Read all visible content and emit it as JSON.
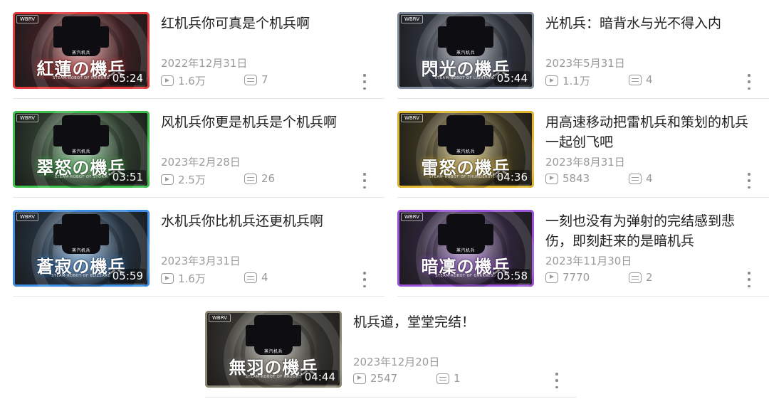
{
  "videos": [
    {
      "title": "红机兵你可真是个机兵啊",
      "date": "2022年12月31日",
      "views": "1.6万",
      "comments": "7",
      "duration": "05:24",
      "thumb": {
        "logo": "WBRV",
        "subtitle": "蒸汽机兵",
        "title": "紅蓮の機兵",
        "caption": "STEAM-ROBOT OF INFERNO",
        "bg": "#3a1f22",
        "accent": "#e23a3a"
      }
    },
    {
      "title": "光机兵：暗背水与光不得入内",
      "date": "2023年5月31日",
      "views": "1.1万",
      "comments": "4",
      "duration": "05:44",
      "thumb": {
        "logo": "WBRV",
        "subtitle": "蒸汽机兵",
        "title": "閃光の機兵",
        "caption": "STEAM-ROBOT OF LIGHTNING",
        "bg": "#2b2f38",
        "accent": "#7f8a9c"
      }
    },
    {
      "title": "风机兵你更是机兵是个机兵啊",
      "date": "2023年2月28日",
      "views": "2.5万",
      "comments": "26",
      "duration": "03:51",
      "thumb": {
        "logo": "WBRV",
        "subtitle": "蒸汽机兵",
        "title": "翠怒の機兵",
        "caption": "STEAM-ROBOT OF STORM",
        "bg": "#2d3b2d",
        "accent": "#3bbf4a"
      }
    },
    {
      "title": "用高速移动把雷机兵和策划的机兵一起创飞吧",
      "date": "2023年8月31日",
      "views": "5843",
      "comments": "4",
      "duration": "04:36",
      "thumb": {
        "logo": "WBRV",
        "subtitle": "蒸汽机兵",
        "title": "雷怒の機兵",
        "caption": "STEAM-ROBOT OF THUNDERSTORM",
        "bg": "#3a3420",
        "accent": "#e0b62c"
      }
    },
    {
      "title": "水机兵你比机兵还更机兵啊",
      "date": "2023年3月31日",
      "views": "1.6万",
      "comments": "4",
      "duration": "05:59",
      "thumb": {
        "logo": "WBRV",
        "subtitle": "蒸汽机兵",
        "title": "蒼寂の機兵",
        "caption": "STEAM-ROBOT OF BLIZZARD",
        "bg": "#23303d",
        "accent": "#3b8be0"
      }
    },
    {
      "title": "一刻也没有为弹射的完结感到悲伤，即刻赶来的是暗机兵",
      "date": "2023年11月30日",
      "views": "7770",
      "comments": "2",
      "duration": "05:58",
      "thumb": {
        "logo": "WBRV",
        "subtitle": "蒸汽机兵",
        "title": "暗凜の機兵",
        "caption": "STEAM-ROBOT OF DARKNESS",
        "bg": "#2d2438",
        "accent": "#9b52d8"
      }
    },
    {
      "title": "机兵道，堂堂完结！",
      "date": "2023年12月20日",
      "views": "2547",
      "comments": "1",
      "duration": "04:44",
      "thumb": {
        "logo": "WBRV",
        "subtitle": "蒸汽机兵",
        "title": "無羽の機兵",
        "caption": "STEAM-ROBOT OF NAUGHT",
        "bg": "#34332e",
        "accent": "#8a8676"
      }
    }
  ]
}
